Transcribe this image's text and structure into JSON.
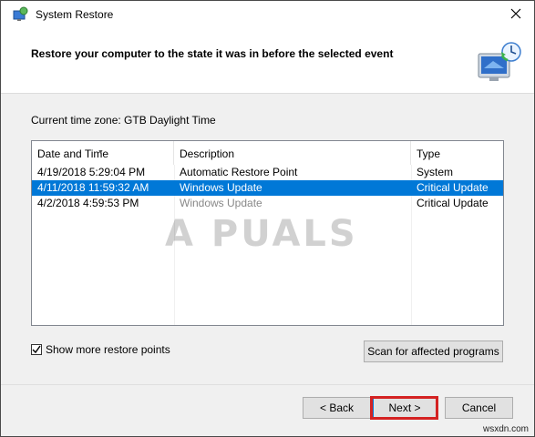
{
  "window": {
    "title": "System Restore",
    "icon": "system-restore-icon"
  },
  "header": {
    "instruction": "Restore your computer to the state it was in before the selected event",
    "icon": "restore-monitor-icon"
  },
  "timezone": "Current time zone: GTB Daylight Time",
  "table": {
    "columns": [
      "Date and Time",
      "Description",
      "Type"
    ],
    "rows": [
      {
        "date": "4/19/2018 5:29:04 PM",
        "description": "Automatic Restore Point",
        "type": "System",
        "selected": false
      },
      {
        "date": "4/11/2018 11:59:32 AM",
        "description": "Windows Update",
        "type": "Critical Update",
        "selected": true
      },
      {
        "date": "4/2/2018 4:59:53 PM",
        "description": "Windows Update",
        "type": "Critical Update",
        "selected": false
      }
    ]
  },
  "watermark": "A PUALS",
  "show_more": {
    "label": "Show more restore points",
    "checked": true
  },
  "buttons": {
    "scan": "Scan for affected programs",
    "back": "< Back",
    "next": "Next >",
    "cancel": "Cancel"
  },
  "site": "wsxdn.com",
  "colors": {
    "selection": "#0078d7",
    "highlight_box": "#d42222"
  }
}
